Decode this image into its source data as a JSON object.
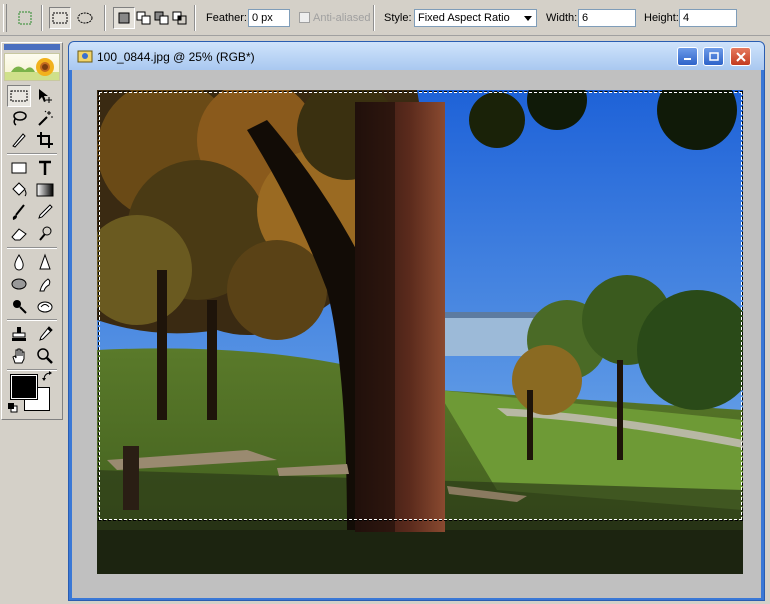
{
  "options_bar": {
    "feather_label": "Feather:",
    "feather_value": "0 px",
    "anti_aliased_label": "Anti-aliased",
    "style_label": "Style:",
    "style_value": "Fixed Aspect Ratio",
    "width_label": "Width:",
    "width_value": "6",
    "height_label": "Height:",
    "height_value": "4"
  },
  "document": {
    "title": "100_0844.jpg @ 25% (RGB*)"
  },
  "colors": {
    "title_bar": "#a9c8f0",
    "window_frame": "#3a78d6",
    "canvas_gray": "#c0c0c0",
    "foreground_color": "#000000",
    "background_color": "#ffffff"
  }
}
